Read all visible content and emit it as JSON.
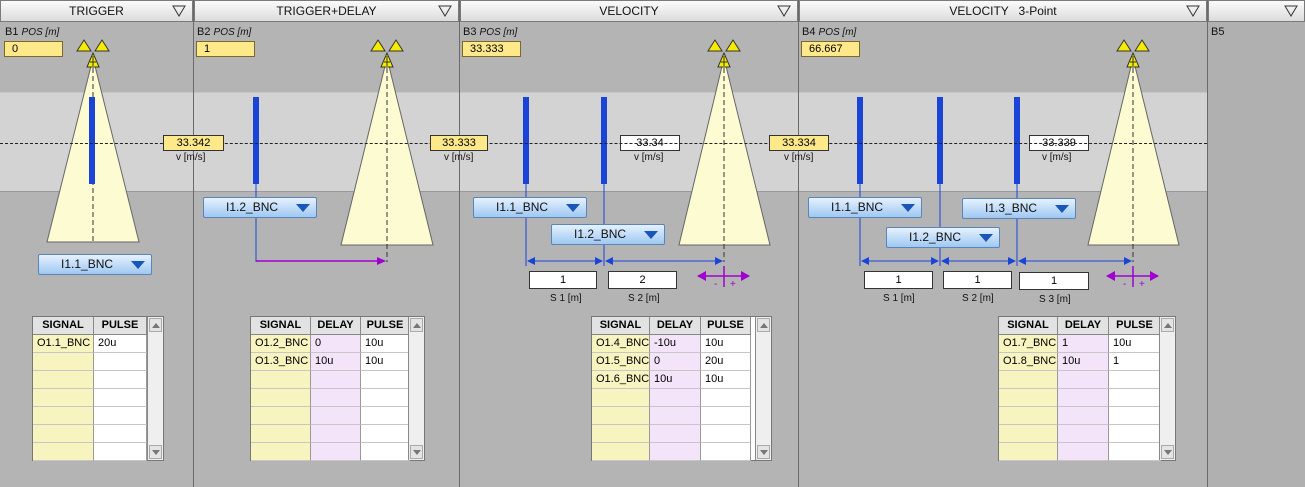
{
  "sections": {
    "b1": {
      "header": "TRIGGER",
      "label": "B1",
      "pos_label": "POS [m]",
      "pos": "0"
    },
    "b2": {
      "header": "TRIGGER+DELAY",
      "label": "B2",
      "pos_label": "POS [m]",
      "pos": "1"
    },
    "b3": {
      "header": "VELOCITY",
      "label": "B3",
      "pos_label": "POS [m]",
      "pos": "33.333"
    },
    "b4": {
      "header": "VELOCITY   3-Point",
      "label": "B4",
      "pos_label": "POS [m]",
      "pos": "66.667"
    },
    "b5": {
      "header": "",
      "label": "B5"
    }
  },
  "velocity": {
    "b1": "33.342",
    "b2": "33.333",
    "b3_measured": "33.34",
    "b3": "33.334",
    "b4_measured": "33.339",
    "unit_label": "v  [m/s]"
  },
  "inputs": {
    "b1_i1": "I1.1_BNC",
    "b2_i2": "I1.2_BNC",
    "b3_i1": "I1.1_BNC",
    "b3_i2": "I1.2_BNC",
    "b4_i1": "I1.1_BNC",
    "b4_i2": "I1.2_BNC",
    "b4_i3": "I1.3_BNC"
  },
  "distances": {
    "b3_s1": "1",
    "b3_s2": "2",
    "b4_s1": "1",
    "b4_s2": "1",
    "b4_s3": "1",
    "s1_label": "S 1 [m]",
    "s2_label": "S 2 [m]",
    "s3_label": "S 3 [m]",
    "minus": "-",
    "plus": "+"
  },
  "tables": {
    "headers": {
      "signal": "SIGNAL",
      "delay": "DELAY",
      "pulse": "PULSE"
    },
    "b1": [
      {
        "signal": "O1.1_BNC",
        "pulse": "20u"
      }
    ],
    "b2": [
      {
        "signal": "O1.2_BNC",
        "delay": "0",
        "pulse": "10u"
      },
      {
        "signal": "O1.3_BNC",
        "delay": "10u",
        "pulse": "10u"
      }
    ],
    "b3": [
      {
        "signal": "O1.4_BNC",
        "delay": "-10u",
        "pulse": "10u"
      },
      {
        "signal": "O1.5_BNC",
        "delay": "0",
        "pulse": "20u"
      },
      {
        "signal": "O1.6_BNC",
        "delay": "10u",
        "pulse": "10u"
      }
    ],
    "b4": [
      {
        "signal": "O1.7_BNC",
        "delay": "1",
        "pulse": "10u"
      },
      {
        "signal": "O1.8_BNC",
        "delay": "10u",
        "pulse": "1"
      }
    ]
  },
  "colors": {
    "beam": "#fdfbd2",
    "sensor": "#1a44d8",
    "position_box": "#fde98a",
    "delay_line": "#a000d0"
  }
}
